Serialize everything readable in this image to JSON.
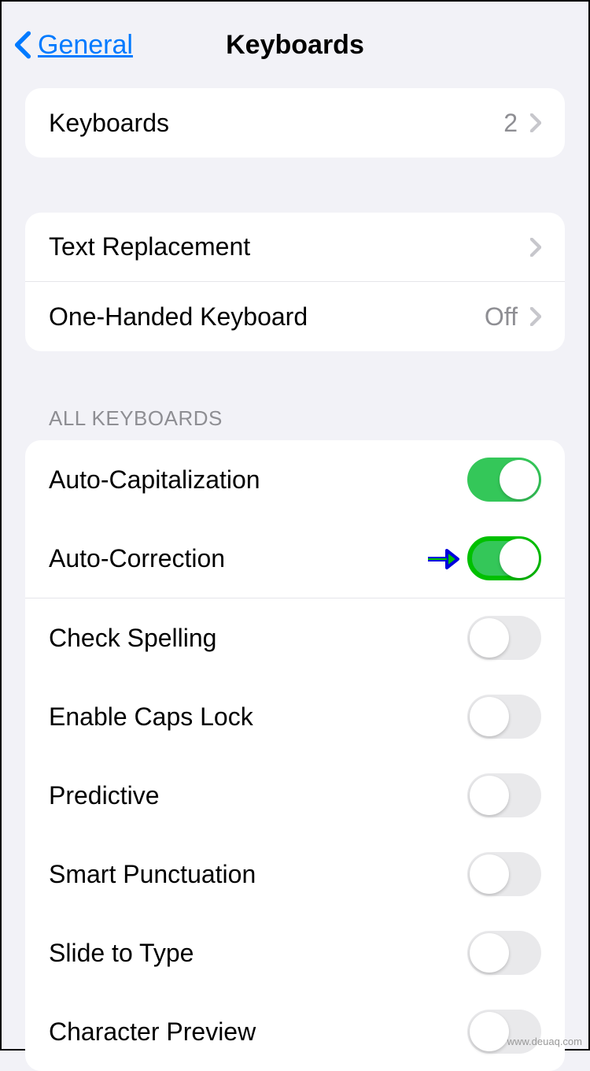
{
  "header": {
    "back_label": "General",
    "title": "Keyboards"
  },
  "section1": {
    "keyboards_label": "Keyboards",
    "keyboards_count": "2"
  },
  "section2": {
    "text_replacement_label": "Text Replacement",
    "one_handed_label": "One-Handed Keyboard",
    "one_handed_value": "Off"
  },
  "section3": {
    "header": "ALL KEYBOARDS",
    "items": [
      {
        "label": "Auto-Capitalization",
        "on": true,
        "highlight": false
      },
      {
        "label": "Auto-Correction",
        "on": true,
        "highlight": true
      },
      {
        "label": "Check Spelling",
        "on": false,
        "highlight": false
      },
      {
        "label": "Enable Caps Lock",
        "on": false,
        "highlight": false
      },
      {
        "label": "Predictive",
        "on": false,
        "highlight": false
      },
      {
        "label": "Smart Punctuation",
        "on": false,
        "highlight": false
      },
      {
        "label": "Slide to Type",
        "on": false,
        "highlight": false
      },
      {
        "label": "Character Preview",
        "on": false,
        "highlight": false
      }
    ]
  },
  "watermark": "www.deuaq.com"
}
